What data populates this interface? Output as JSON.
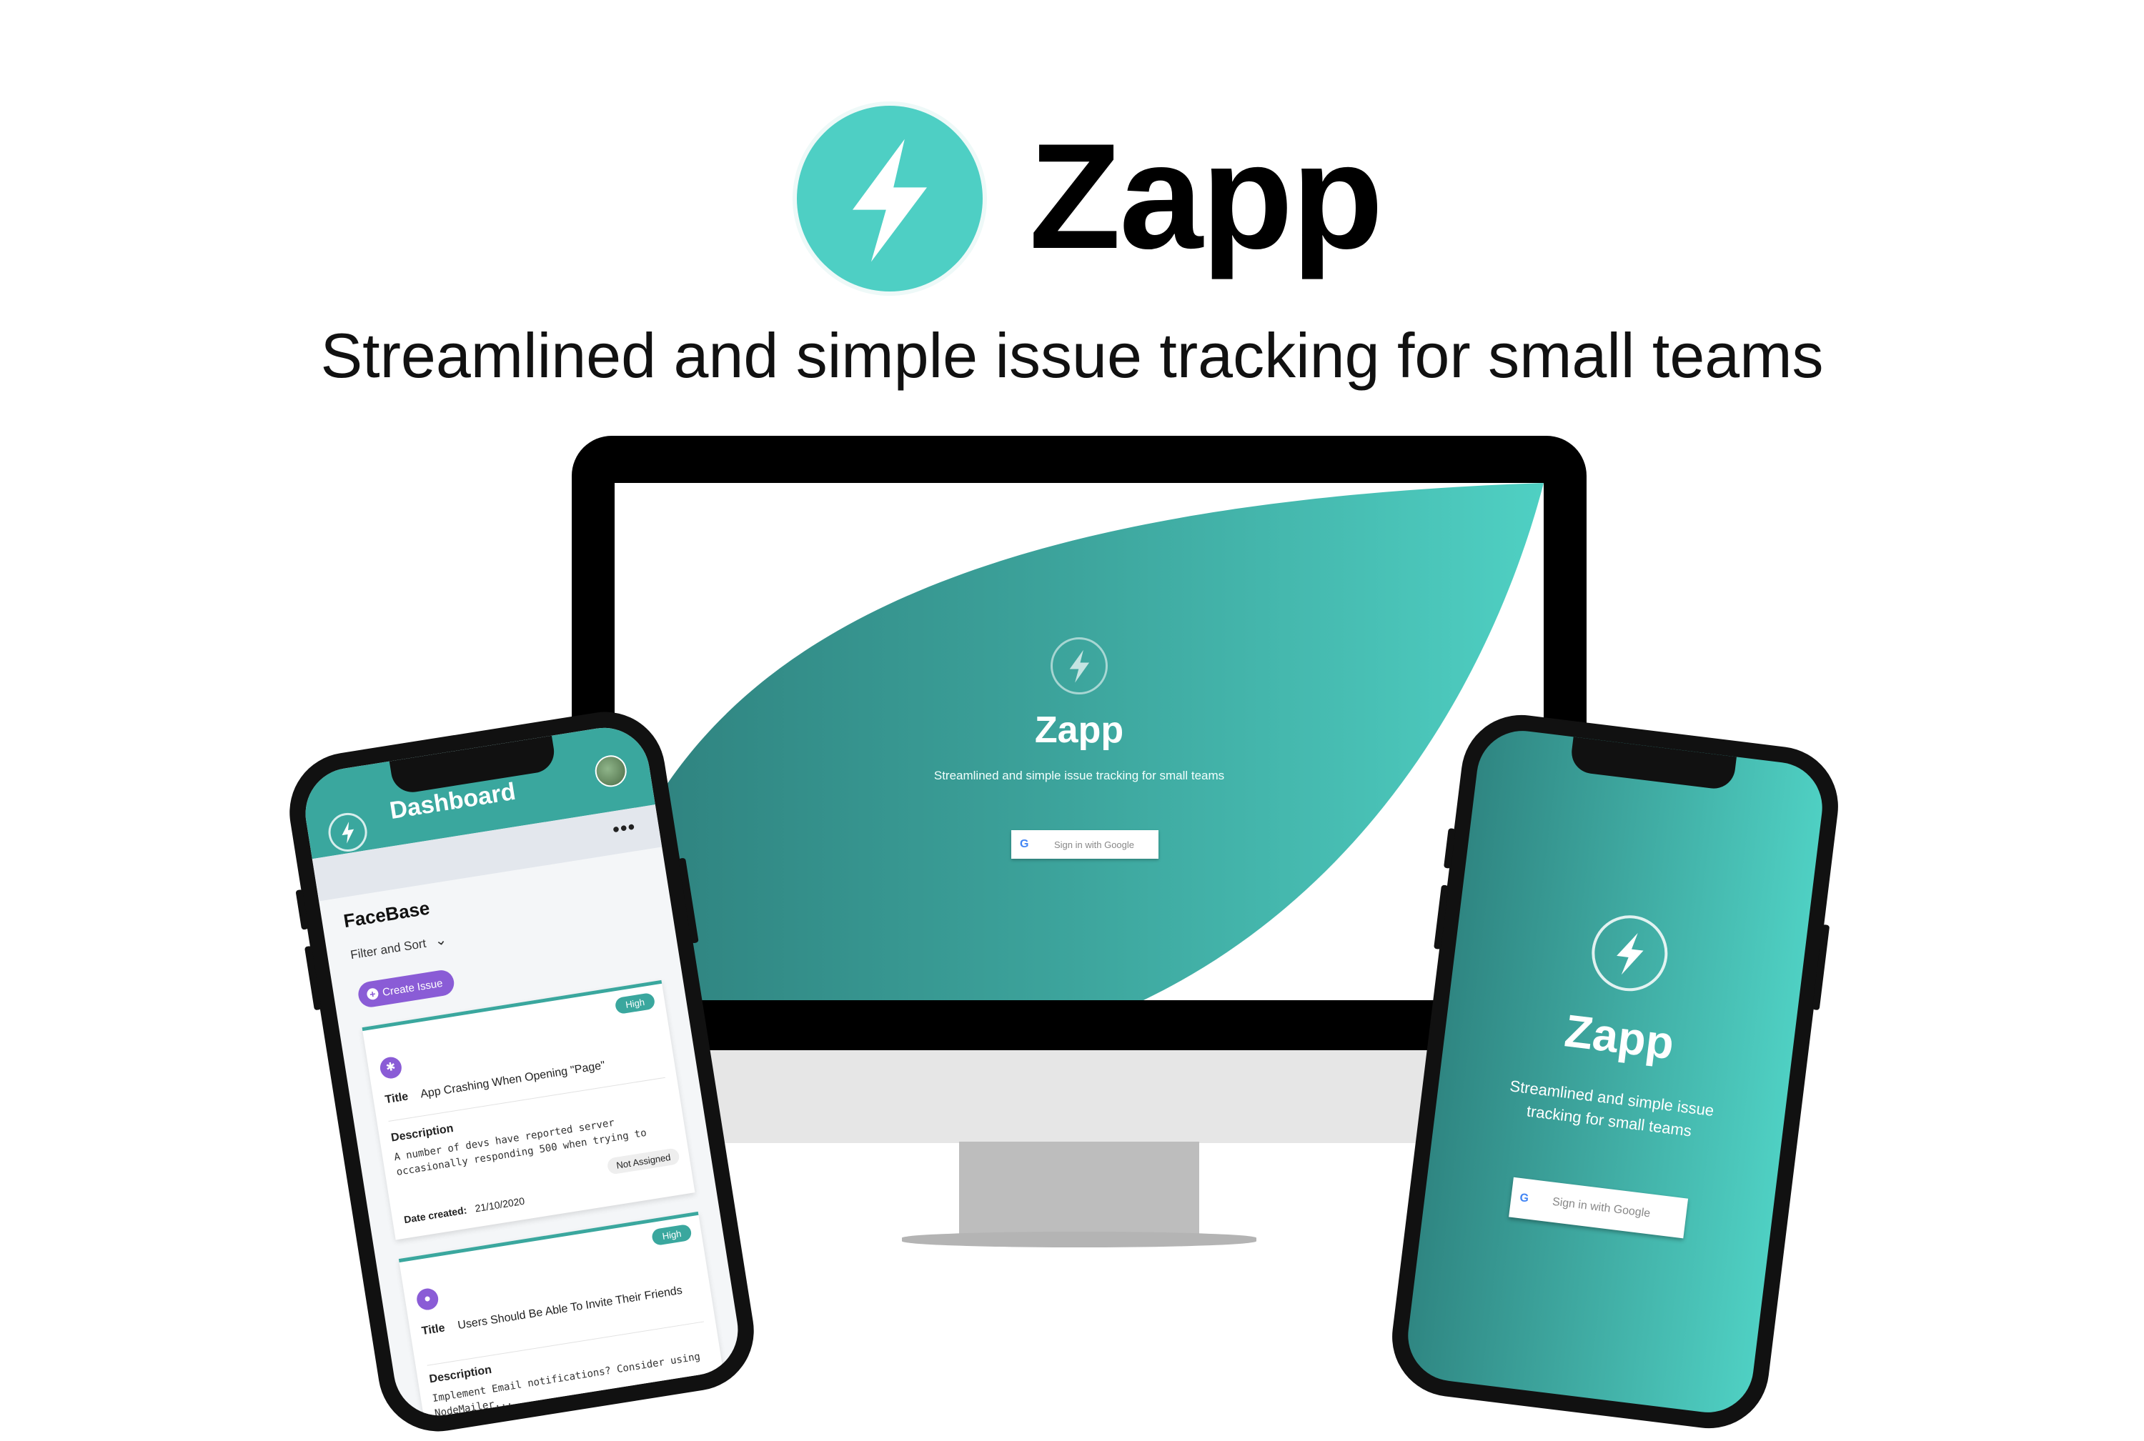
{
  "brand": {
    "name": "Zapp",
    "tagline": "Streamlined and simple issue tracking for small teams",
    "accent_color": "#4ecfc4",
    "icon": "lightning-bolt-icon"
  },
  "desktop": {
    "app_title": "Zapp",
    "subtitle": "Streamlined and simple issue tracking for small teams",
    "signin_label": "Sign in with Google",
    "google_icon": "G"
  },
  "mobile_signin": {
    "app_title": "Zapp",
    "subtitle": "Streamlined and simple issue tracking for small teams",
    "signin_label": "Sign in with Google",
    "google_icon": "G"
  },
  "dashboard": {
    "title": "Dashboard",
    "more_icon": "•••",
    "project_name": "FaceBase",
    "filter_label": "Filter and Sort",
    "filter_chevron": "⌄",
    "create_label": "Create Issue",
    "create_icon": "+",
    "issues": [
      {
        "priority": "High",
        "type_icon": "bug-icon",
        "type_glyph": "✱",
        "title_label": "Title",
        "title": "App Crashing When Opening \"Page\"",
        "description_label": "Description",
        "description": "A number of devs have reported server occasionally responding 500 when trying to",
        "assignee": "Not Assigned",
        "date_label": "Date created:",
        "date": "21/10/2020"
      },
      {
        "priority": "High",
        "type_icon": "lightbulb-icon",
        "type_glyph": "●",
        "title_label": "Title",
        "title": "Users Should Be Able To Invite Their Friends",
        "description_label": "Description",
        "description": "Implement Email notifications? Consider using NodeMailer..."
      }
    ]
  }
}
